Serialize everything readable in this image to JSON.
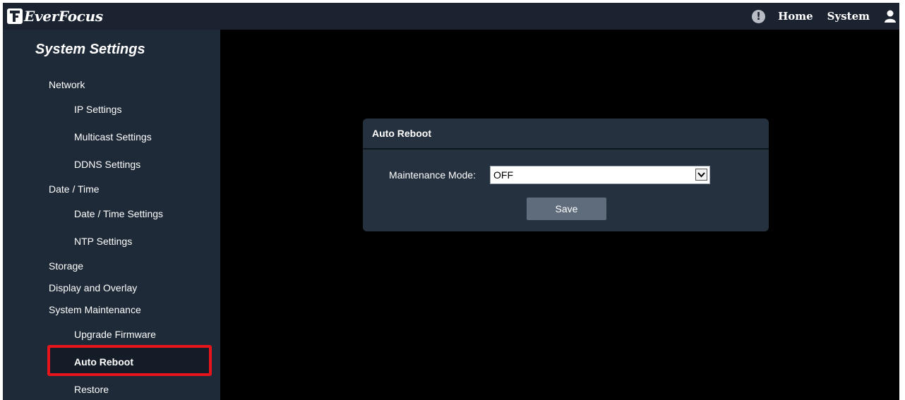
{
  "header": {
    "brand": "EverFocus",
    "nav": {
      "home": "Home",
      "system": "System"
    },
    "icons": {
      "alert": "alert-icon",
      "user": "user-icon"
    }
  },
  "sidebar": {
    "title": "System Settings",
    "items": [
      {
        "label": "Network",
        "level": 1
      },
      {
        "label": "IP Settings",
        "level": 2
      },
      {
        "label": "Multicast Settings",
        "level": 2
      },
      {
        "label": "DDNS Settings",
        "level": 2
      },
      {
        "label": "Date / Time",
        "level": 1
      },
      {
        "label": "Date / Time Settings",
        "level": 2
      },
      {
        "label": "NTP Settings",
        "level": 2
      },
      {
        "label": "Storage",
        "level": 1
      },
      {
        "label": "Display and Overlay",
        "level": 1
      },
      {
        "label": "System Maintenance",
        "level": 1
      },
      {
        "label": "Upgrade Firmware",
        "level": 2
      },
      {
        "label": "Auto Reboot",
        "level": 2,
        "active": true
      },
      {
        "label": "Restore",
        "level": 2
      }
    ]
  },
  "panel": {
    "title": "Auto Reboot",
    "maintenance_label": "Maintenance Mode:",
    "maintenance_value": "OFF",
    "save_label": "Save"
  },
  "colors": {
    "topbar": "#1b2330",
    "sidebar": "#1f2a38",
    "panel": "#26313f",
    "highlight": "#e8141b",
    "button": "#5e6c7b"
  }
}
